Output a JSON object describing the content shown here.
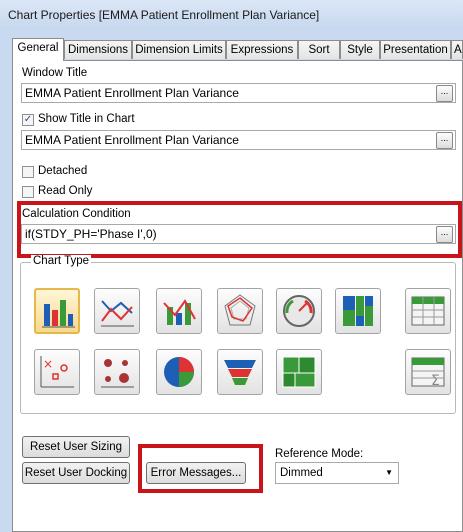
{
  "window": {
    "title": "Chart Properties [EMMA Patient Enrollment Plan Variance]"
  },
  "tabs": [
    "General",
    "Dimensions",
    "Dimension Limits",
    "Expressions",
    "Sort",
    "Style",
    "Presentation",
    "Axe"
  ],
  "general": {
    "window_title_label": "Window Title",
    "window_title_value": "EMMA Patient Enrollment Plan Variance",
    "show_title_label": "Show Title in Chart",
    "show_title_checked": true,
    "chart_title_value": "EMMA Patient Enrollment Plan Variance",
    "detached_label": "Detached",
    "read_only_label": "Read Only",
    "calc_condition_label": "Calculation Condition",
    "calc_condition_value": "if(STDY_PH='Phase I',0)",
    "chart_type_label": "Chart Type",
    "dots": "...",
    "check": "✓"
  },
  "chart_types": [
    {
      "name": "bar-chart",
      "selected": true
    },
    {
      "name": "line-chart"
    },
    {
      "name": "combo-chart"
    },
    {
      "name": "radar-chart"
    },
    {
      "name": "gauge-chart"
    },
    {
      "name": "mekko-chart"
    },
    {
      "name": "pivot-table"
    },
    {
      "name": "scatter-chart"
    },
    {
      "name": "grid-chart"
    },
    {
      "name": "pie-chart"
    },
    {
      "name": "funnel-chart"
    },
    {
      "name": "block-chart"
    },
    {
      "name": "straight-table"
    }
  ],
  "buttons": {
    "reset_user_sizing": "Reset User Sizing",
    "reset_user_docking": "Reset User Docking",
    "error_messages": "Error Messages..."
  },
  "reference_mode": {
    "label": "Reference Mode:",
    "value": "Dimmed"
  },
  "colors": {
    "highlight": "#c8141a",
    "selected_button": "#f6d88e",
    "titlebar": "#c6d8ee"
  }
}
